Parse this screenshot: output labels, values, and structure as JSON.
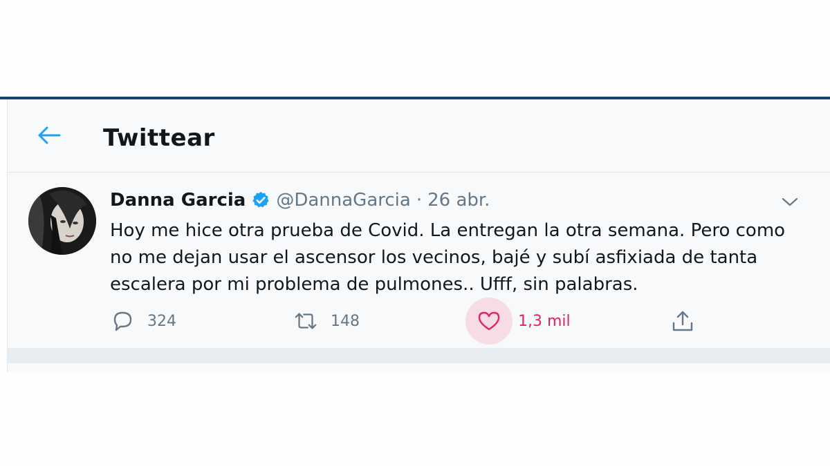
{
  "header": {
    "title": "Twittear",
    "back_icon": "arrow-left-icon"
  },
  "tweet": {
    "author_name": "Danna Garcia",
    "verified_icon": "verified-badge-icon",
    "handle": "@DannaGarcia",
    "separator": "·",
    "date": "26 abr.",
    "text": "Hoy me hice otra prueba de Covid. La entregan la otra semana. Pero como no me dejan usar el ascensor los vecinos, bajé y subí asfixiada de tanta escalera por mi problema de pulmones.. Ufff, sin palabras.",
    "replies": "324",
    "retweets": "148",
    "likes": "1,3 mil"
  },
  "colors": {
    "accent_blue": "#1da1f2",
    "like_pink": "#e0245e",
    "top_border": "#15426b"
  }
}
